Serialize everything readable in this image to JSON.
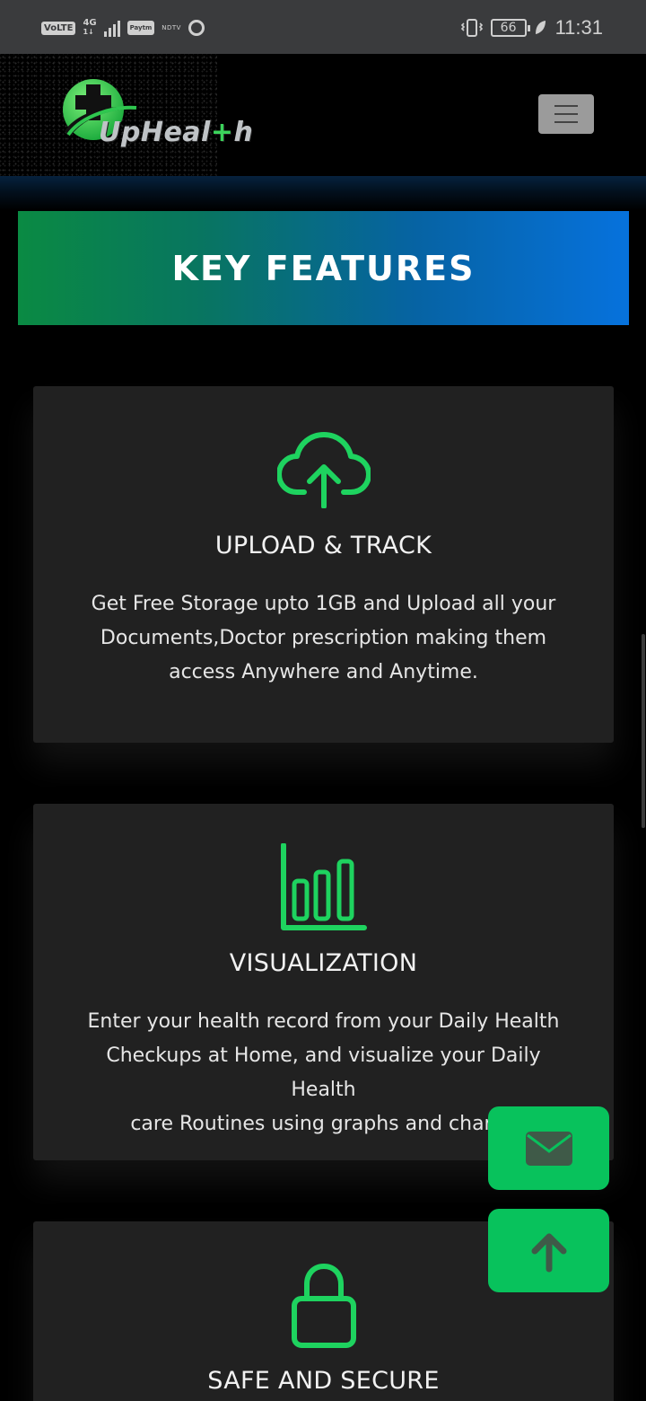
{
  "status_bar": {
    "volte": "VoLTE",
    "network": "4G",
    "network_sub": "1↓",
    "paytm": "Paytm",
    "ndtv": "NDTV",
    "battery": "66",
    "time": "11:31"
  },
  "navbar": {
    "logo_text_1": "UpHeal",
    "logo_plus": "+",
    "logo_text_2": "h"
  },
  "banner": {
    "title": "KEY FEATURES"
  },
  "features": [
    {
      "icon": "cloud-upload-icon",
      "title": "UPLOAD & TRACK",
      "line1": "Get Free Storage upto 1GB and Upload all your",
      "line2": "Documents,Doctor prescription making them",
      "line3": "access Anywhere and Anytime."
    },
    {
      "icon": "bar-chart-icon",
      "title": "VISUALIZATION",
      "line1": "Enter your health record from your Daily Health",
      "line2": "Checkups at Home, and visualize your Daily Health",
      "line3": "care Routines using graphs and charts."
    },
    {
      "icon": "lock-icon",
      "title": "SAFE AND SECURE"
    }
  ],
  "colors": {
    "accent_green": "#08c25c",
    "icon_green": "#1ed35f",
    "card_bg": "#212121",
    "banner_start": "#0a8a43",
    "banner_end": "#0672dd"
  }
}
